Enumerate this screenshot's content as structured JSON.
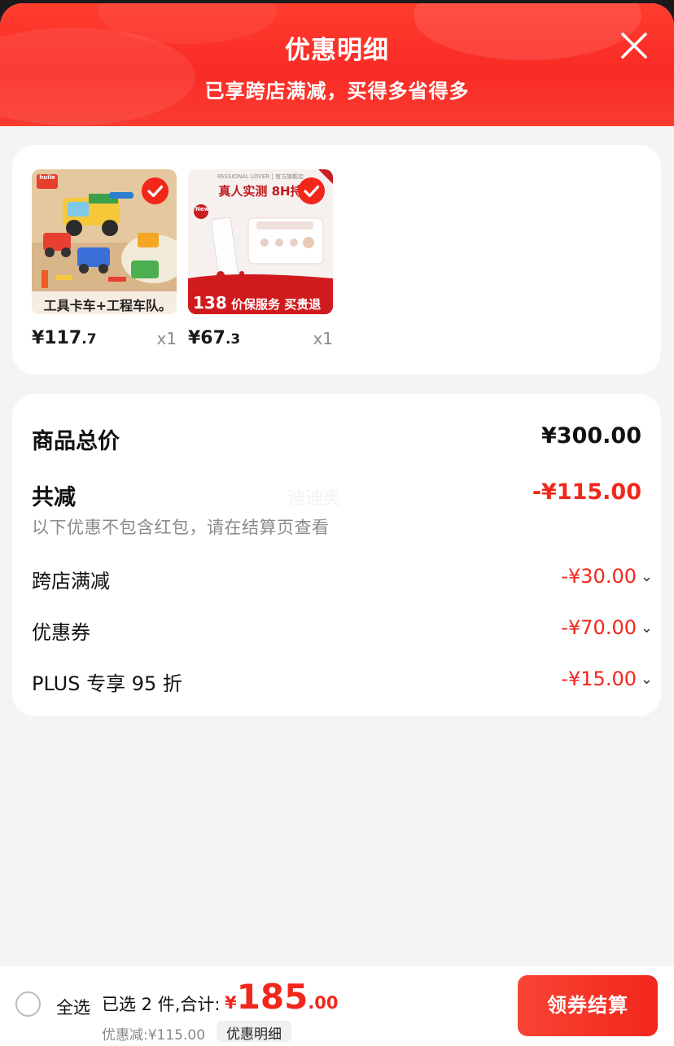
{
  "header": {
    "title": "优惠明细",
    "subtitle": "已享跨店满减，买得多省得多"
  },
  "products": [
    {
      "image_caption": "工具卡车+工程车队。",
      "brand_badge": "huile",
      "price_int": "¥117",
      "price_dec": ".7",
      "qty": "x1"
    },
    {
      "image_brand": "PASSIONAL LOVER | 官方旗舰店",
      "image_headline": "真人实测 8H持",
      "image_badge": "New",
      "image_banner_num": "138",
      "image_banner_text": "价保服务 买贵退差价",
      "price_int": "¥67",
      "price_dec": ".3",
      "qty": "x1"
    }
  ],
  "summary": {
    "total_label": "商品总价",
    "total_value": "¥300.00",
    "reduce_label": "共减",
    "reduce_value": "-¥115.00",
    "note": "以下优惠不包含红包，请在结算页查看",
    "watermark": "迪迪奥",
    "items": [
      {
        "label": "跨店满减",
        "value": "-¥30.00"
      },
      {
        "label": "优惠券",
        "value": "-¥70.00"
      },
      {
        "label": "PLUS 专享 95 折",
        "value": "-¥15.00"
      }
    ]
  },
  "footer": {
    "select_all": "全选",
    "selected_text": "已选 2 件,合计:",
    "total_currency": "¥",
    "total_int": "185",
    "total_dec": ".00",
    "discount_text": "优惠减:¥115.00",
    "detail_tag": "优惠明细",
    "checkout": "领券结算"
  },
  "colors": {
    "accent": "#f2271c",
    "header_bg": "#ff3d2e",
    "page_bg": "#f4f4f4"
  }
}
